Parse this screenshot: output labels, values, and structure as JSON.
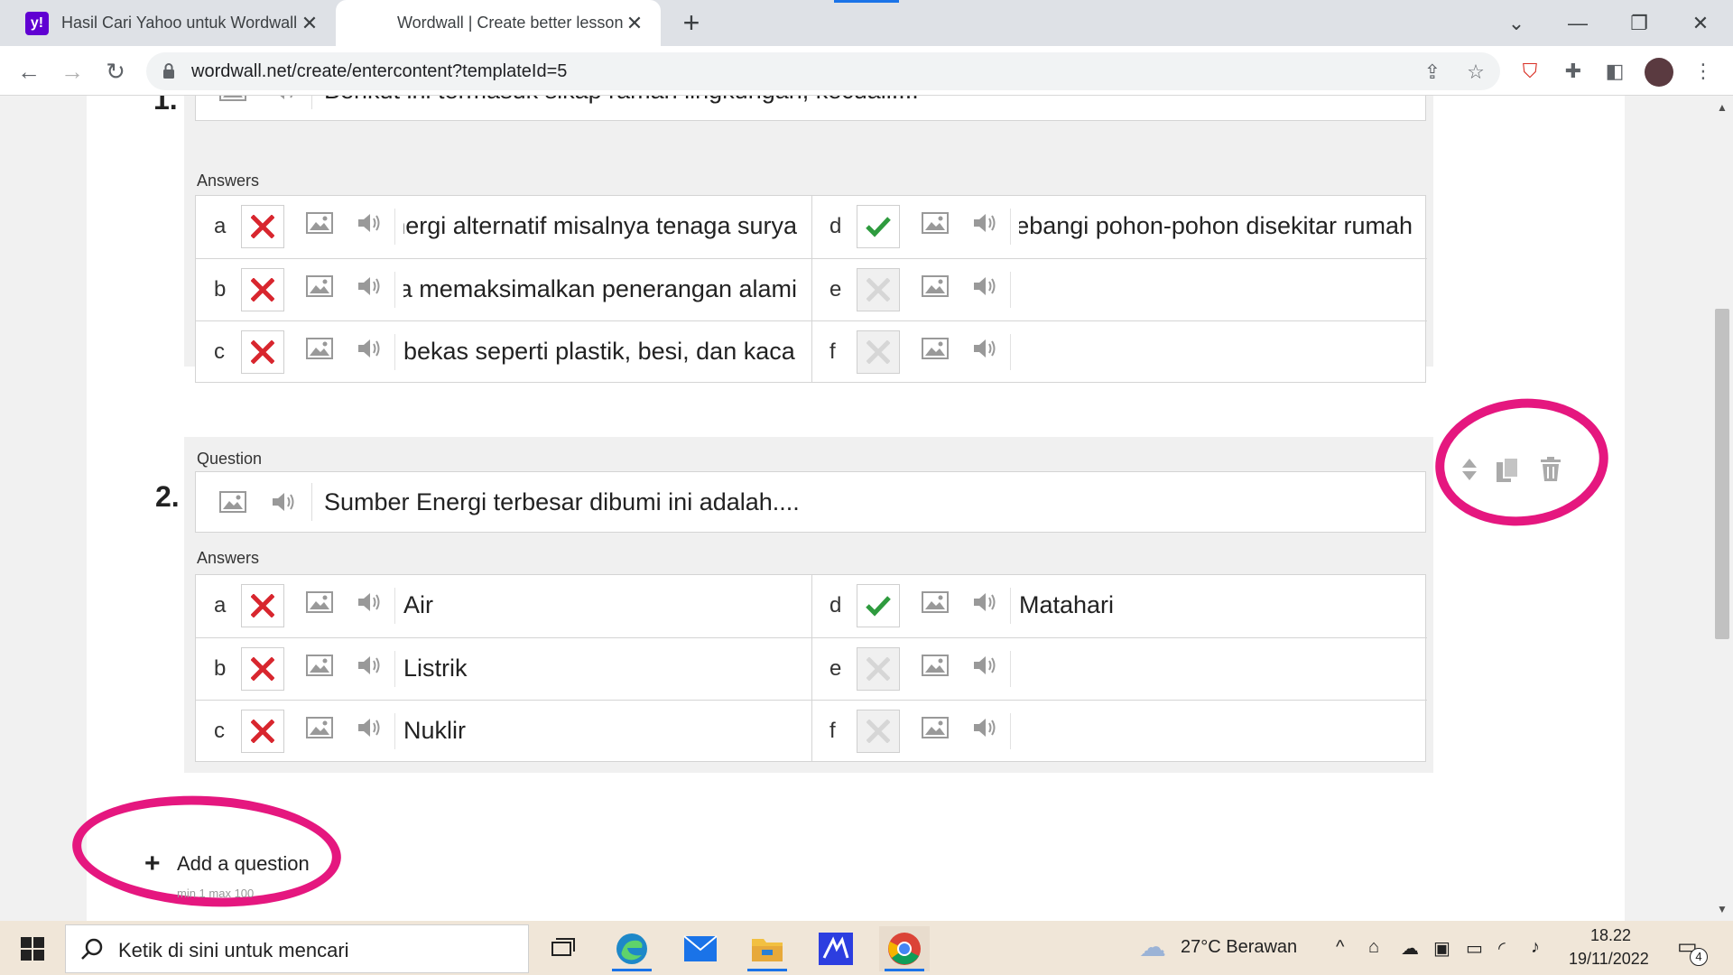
{
  "browser": {
    "tabs": [
      {
        "title": "Hasil Cari Yahoo untuk Wordwall",
        "favicon": "yahoo-favicon",
        "active": false
      },
      {
        "title": "Wordwall | Create better lessons",
        "favicon": "wordwall-favicon",
        "active": true
      }
    ],
    "url": "wordwall.net/create/entercontent?templateId=5",
    "new_tab_icon": "+",
    "window_controls": {
      "minimize": "—",
      "restore": "❐",
      "close": "✕"
    }
  },
  "editor": {
    "questions": [
      {
        "number": "1.",
        "question_text": "Berikut ini termasuk sikap ramah lingkungan, kecuali....",
        "answers_label": "Answers",
        "answers": [
          {
            "letter": "a",
            "state": "wrong",
            "text": "Menggunakan energi alternatif misalnya tenaga surya"
          },
          {
            "letter": "b",
            "state": "wrong",
            "text": "Membuka jendela memaksimalkan penerangan alami"
          },
          {
            "letter": "c",
            "state": "wrong",
            "text": "bekas seperti plastik, besi, dan kaca"
          },
          {
            "letter": "d",
            "state": "correct",
            "text": "Menebangi pohon-pohon disekitar rumah"
          },
          {
            "letter": "e",
            "state": "empty",
            "text": ""
          },
          {
            "letter": "f",
            "state": "empty",
            "text": ""
          }
        ]
      },
      {
        "number": "2.",
        "question_label": "Question",
        "question_text": "Sumber Energi terbesar dibumi ini adalah....",
        "answers_label": "Answers",
        "answers": [
          {
            "letter": "a",
            "state": "wrong",
            "text": "Air"
          },
          {
            "letter": "b",
            "state": "wrong",
            "text": "Listrik"
          },
          {
            "letter": "c",
            "state": "wrong",
            "text": "Nuklir"
          },
          {
            "letter": "d",
            "state": "correct",
            "text": "Matahari"
          },
          {
            "letter": "e",
            "state": "empty",
            "text": ""
          },
          {
            "letter": "f",
            "state": "empty",
            "text": ""
          }
        ]
      }
    ],
    "add_question": {
      "label": "Add a question",
      "hint": "min 1   max 100"
    },
    "annotation_color": "#e5177f"
  },
  "taskbar": {
    "search_placeholder": "Ketik di sini untuk mencari",
    "weather": "27°C  Berawan",
    "time": "18.22",
    "date": "19/11/2022",
    "notification_count": "4"
  }
}
